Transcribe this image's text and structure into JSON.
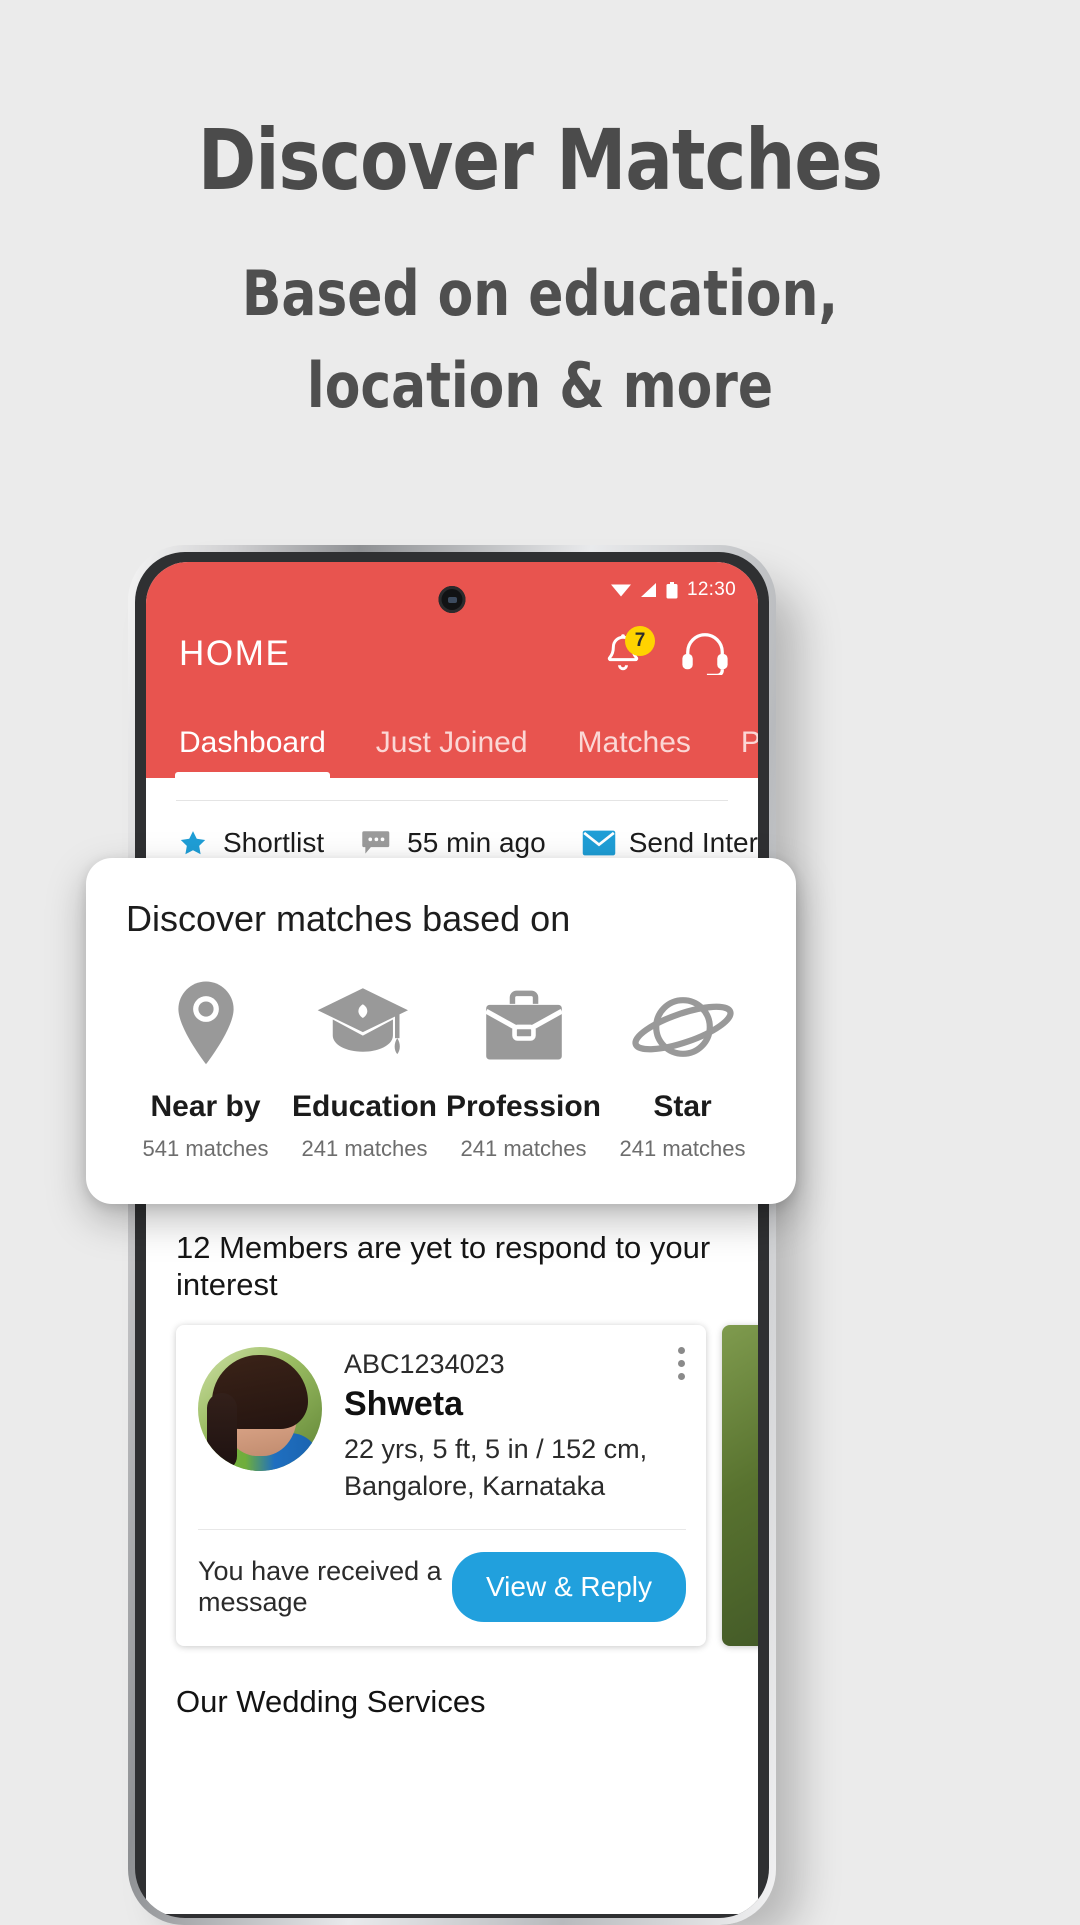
{
  "promo": {
    "title": "Discover Matches",
    "subtitle_line1": "Based on education,",
    "subtitle_line2": "location & more"
  },
  "phone": {
    "statusbar": {
      "time": "12:30",
      "wifi_icon": "wifi-icon",
      "signal_icon": "signal-icon",
      "battery_icon": "battery-icon"
    },
    "header": {
      "title": "HOME",
      "accent_color": "#e8544f",
      "notification_icon": "bell-icon",
      "notification_count": "7",
      "badge_color": "#ffd300",
      "support_icon": "headset-icon"
    },
    "tabs": [
      {
        "label": "Dashboard",
        "active": true
      },
      {
        "label": "Just Joined",
        "active": false
      },
      {
        "label": "Matches",
        "active": false
      },
      {
        "label": "Premiu",
        "active": false
      }
    ],
    "actions": [
      {
        "label": "Shortlist",
        "icon": "star-icon",
        "color": "#1f9ed6"
      },
      {
        "label": "55 min ago",
        "icon": "chat-icon",
        "color": "#9b9b9b"
      },
      {
        "label": "Send Interest",
        "icon": "envelope-icon",
        "color": "#1f9ed6"
      }
    ],
    "respond_heading": "12 Members are yet to respond to your interest",
    "profile": {
      "id": "ABC1234023",
      "name": "Shweta",
      "details_line1": "22 yrs, 5 ft, 5 in / 152 cm,",
      "details_line2": "Bangalore, Karnataka",
      "message": "You have received a message",
      "reply_button": "View & Reply",
      "reply_button_color": "#21a0dd",
      "menu_icon": "kebab-menu-icon"
    },
    "wedding_heading": "Our Wedding Services"
  },
  "overlay": {
    "title": "Discover matches based on",
    "items": [
      {
        "label": "Near by",
        "count": "541 matches",
        "icon": "location-pin-icon"
      },
      {
        "label": "Education",
        "count": "241 matches",
        "icon": "graduation-cap-icon"
      },
      {
        "label": "Profession",
        "count": "241 matches",
        "icon": "briefcase-icon"
      },
      {
        "label": "Star",
        "count": "241 matches",
        "icon": "planet-star-icon"
      }
    ]
  }
}
